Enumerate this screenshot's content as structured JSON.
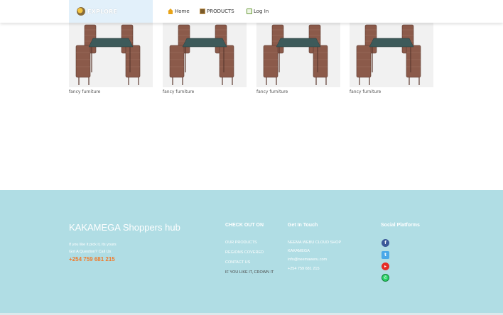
{
  "navbar": {
    "brand_label": "EXPLORE",
    "items": [
      {
        "label": "Home",
        "icon": "home-icon"
      },
      {
        "label": "PRODUCTS",
        "icon": "products-icon"
      },
      {
        "label": "Log In",
        "icon": "login-icon"
      }
    ]
  },
  "products": [
    {
      "caption": "fancy furniture"
    },
    {
      "caption": "fancy furniture"
    },
    {
      "caption": "fancy furniture"
    },
    {
      "caption": "fancy furniture"
    }
  ],
  "footer": {
    "brand": "KAKAMEGA Shoppers hub",
    "slogan": "If you like it pick it, its yours",
    "question": "Got A Question? Call Us",
    "phone": "+254 759 681 215",
    "check_out": {
      "heading": "CHECK OUT ON",
      "links": [
        "OUR PRODUCTS",
        "REGIONS COVERED",
        "CONTACT US",
        "IF YOU LIKE IT, CROWN IT"
      ]
    },
    "contact": {
      "heading": "Get In Touch",
      "lines": [
        "NEEMA WEBU CLOUD SHOP",
        "KAKAMEGA",
        "info@neemaweru.com",
        "+254 759 681 215"
      ]
    },
    "social": {
      "heading": "Social Platforms",
      "icons": [
        "facebook-icon",
        "twitter-icon",
        "youtube-icon",
        "whatsapp-icon"
      ]
    }
  },
  "colors": {
    "footer_bg": "#b0dde4",
    "brand_bg": "#e2f0fa",
    "phone": "#f07b2b"
  }
}
